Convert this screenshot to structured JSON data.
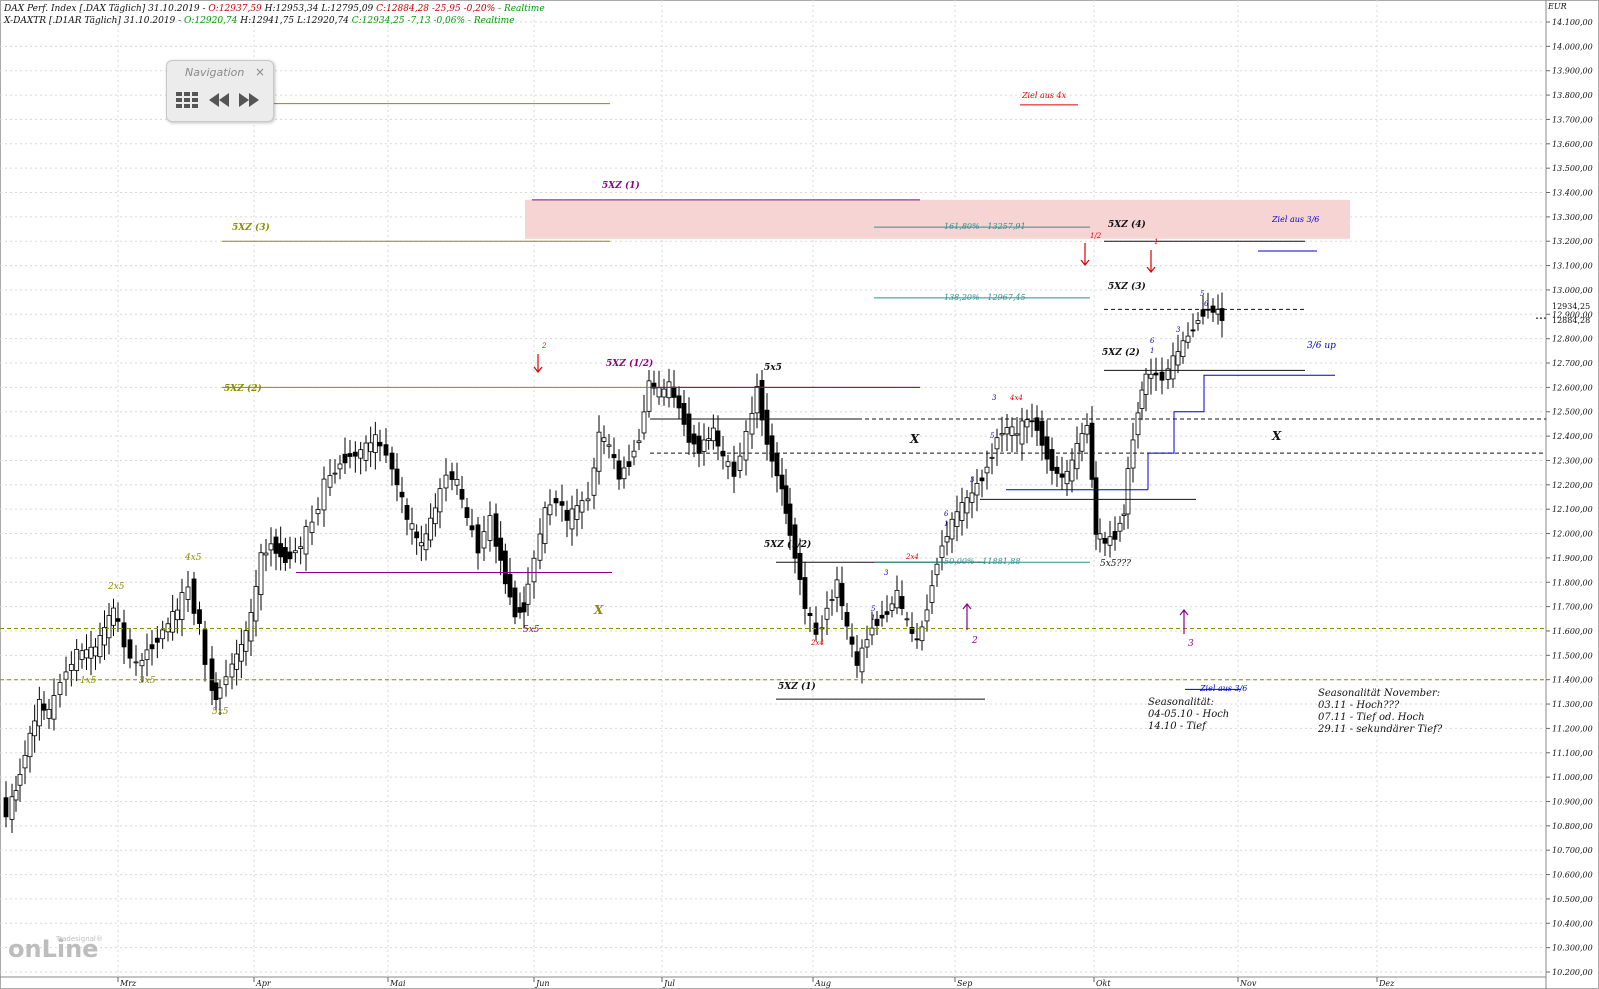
{
  "header": {
    "line1": {
      "name": "DAX Perf. Index [.DAX Täglich] 31.10.2019 - ",
      "open": "O:12937,59",
      "high": " H:12953,34",
      "low": " L:12795,09",
      "close": " C:12884,28 -25,95 -0,20%",
      "realtime": " - Realtime"
    },
    "line2": {
      "name": "X-DAXTR [.D1AR Täglich] 31.10.2019 - ",
      "open": "O:12920,74",
      "high": " H:12941,75",
      "low": " L:12920,74",
      "close": " C:12934,25 -7,13 -0,06%",
      "realtime": " - Realtime"
    }
  },
  "navigation": {
    "title": "Navigation",
    "close_glyph": "×",
    "icons": [
      "grid-icon",
      "rewind-icon",
      "fast-forward-icon"
    ]
  },
  "logo": {
    "main": "onLine",
    "sub": "Tradesignal®"
  },
  "seasonality_october": {
    "title": "Seasonalität:",
    "line1": "04-05.10 - Hoch",
    "line2": "14.10 - Tief"
  },
  "seasonality_november": {
    "title": "Seasonalität November:",
    "line1": "03.11 - Hoch???",
    "line2": "07.11 - Tief od. Hoch",
    "line3": "29.11 - sekundärer Tief?"
  },
  "colors": {
    "olive": "#8c8c00",
    "purple": "#8b008b",
    "teal": "#2f8f8f",
    "blue": "#0000cc",
    "red": "#e00000",
    "black": "#111111",
    "target_zone": "#f7d4d4",
    "realtime_green": "#009900",
    "open_red": "#cc0000"
  },
  "chart_data": {
    "type": "candlestick",
    "currency": "EUR",
    "ylim": [
      10200,
      14100
    ],
    "yticks": [
      10200,
      10300,
      10400,
      10500,
      10600,
      10700,
      10800,
      10900,
      11000,
      11100,
      11200,
      11300,
      11400,
      11500,
      11600,
      11700,
      11800,
      11900,
      12000,
      12100,
      12200,
      12300,
      12400,
      12500,
      12600,
      12700,
      12800,
      12900,
      13000,
      13100,
      13200,
      13300,
      13400,
      13500,
      13600,
      13700,
      13800,
      13900,
      14000,
      14100
    ],
    "tick_format": "de",
    "months": [
      "Mrz",
      "Apr",
      "Mai",
      "Jun",
      "Jul",
      "Aug",
      "Sep",
      "Okt",
      "Nov",
      "Dez"
    ],
    "price_labels": [
      "12934,25",
      "12884,28"
    ],
    "last_close": 12884.28,
    "last_xdax": 12934.25,
    "levels": [
      {
        "label": "5XZ (1)",
        "value": 13370,
        "start": "Jun",
        "end": "Aug+",
        "color": "purple"
      },
      {
        "label": "5XZ (3)",
        "value": 13200,
        "start": "Mrz+",
        "end": "Jun",
        "color": "olive"
      },
      {
        "label": "5XZ (2)",
        "value": 12600,
        "start": "Mrz+",
        "end": "Aug+",
        "color": "olive"
      },
      {
        "label": "5XZ (1/2)",
        "value": 12600,
        "start": "Jul",
        "end": "Aug+",
        "color": "purple"
      },
      {
        "label": "5XZ (4)",
        "value": 13200,
        "start": "Okt",
        "end": "Nov+",
        "color": "black"
      },
      {
        "label": "5XZ (3)",
        "value": 12920,
        "start": "Okt",
        "end": "Nov+",
        "color": "black"
      },
      {
        "label": "5XZ (2)",
        "value": 12670,
        "start": "Okt",
        "end": "Nov+",
        "color": "black"
      },
      {
        "label": "5XZ (1/2)",
        "value": 11880,
        "start": "Aug",
        "end": "Sep",
        "color": "black"
      },
      {
        "label": "5XZ (1)",
        "value": 11320,
        "start": "Aug",
        "end": "Sep",
        "color": "black"
      },
      {
        "label": "161,80% - 13257,91",
        "value": 13257.91,
        "start": "Aug+",
        "end": "Okt",
        "color": "teal"
      },
      {
        "label": "138,20% - 12967,45",
        "value": 12967.45,
        "start": "Aug+",
        "end": "Okt",
        "color": "teal"
      },
      {
        "label": "50,00% - 11881,88",
        "value": 11881.88,
        "start": "Aug+",
        "end": "Okt",
        "color": "teal"
      }
    ],
    "target_zone": [
      13210,
      13370
    ],
    "annotations": [
      "1x5",
      "2x5",
      "3x5",
      "4x5",
      "5x5",
      "5x5",
      "5x5",
      "5x5???",
      "X",
      "X",
      "X",
      "2x4",
      "2x4",
      "4x4",
      "3/6 up",
      "Ziel aus 3/6",
      "Ziel aus 3/6",
      "Ziel aus 4x",
      "1/2",
      "1",
      "2",
      "2",
      "3",
      "1",
      "3",
      "5",
      "6",
      "1",
      "1",
      "3",
      "5",
      "6"
    ],
    "arrows_down": [
      "2",
      "1/2",
      "1"
    ],
    "arrows_up": [
      "2",
      "3"
    ]
  }
}
